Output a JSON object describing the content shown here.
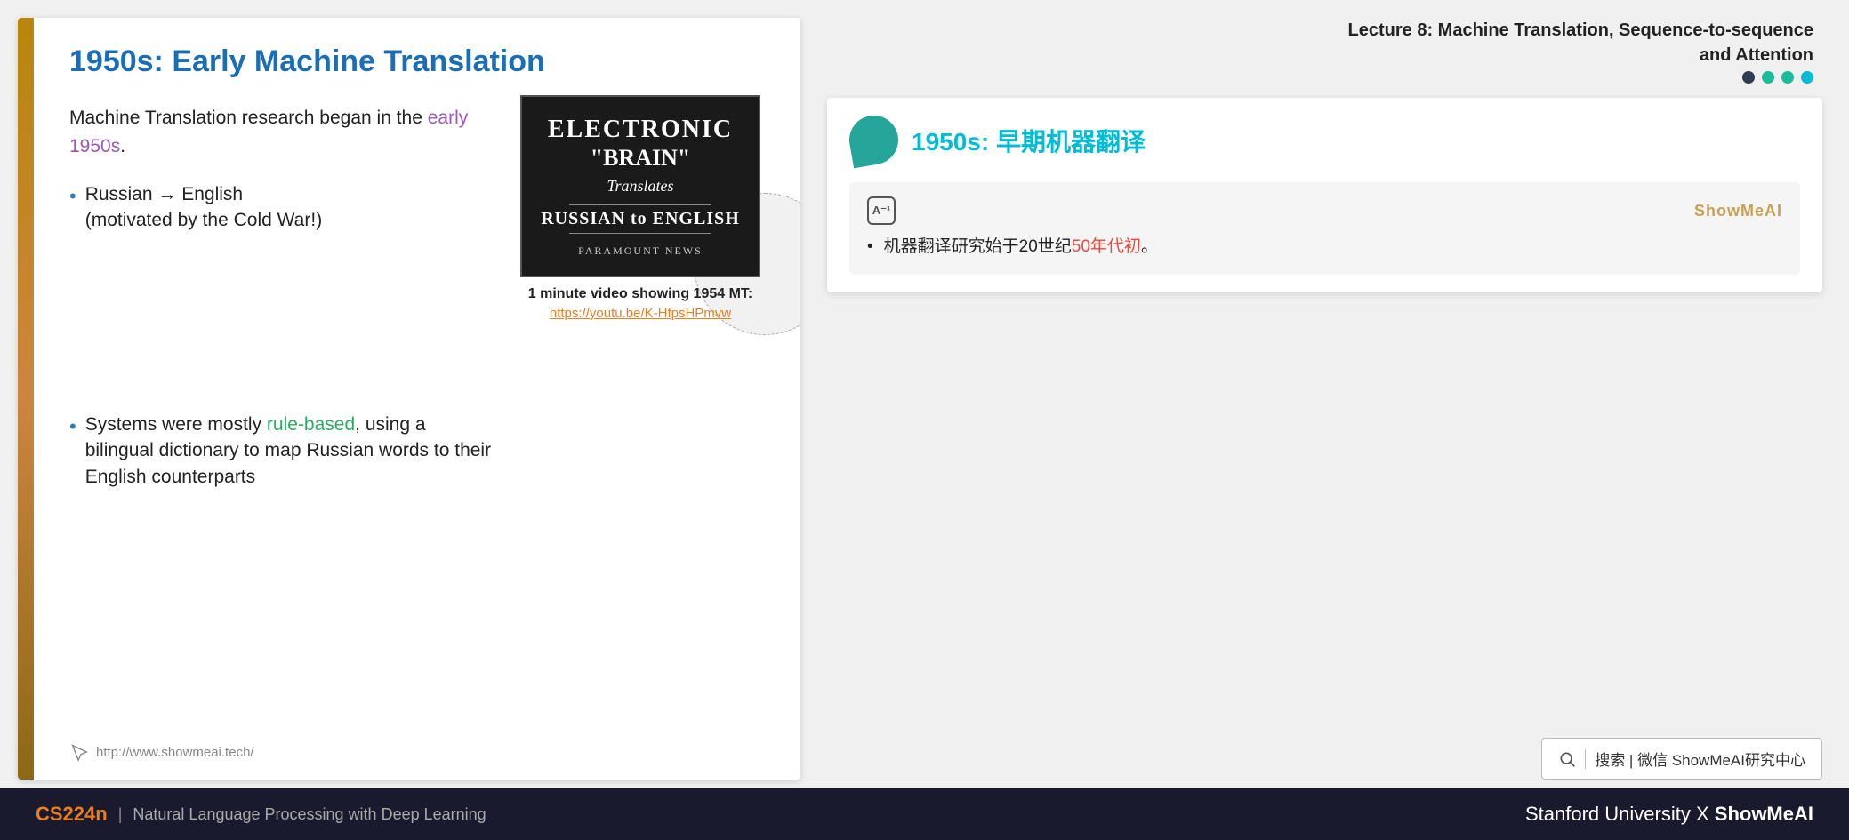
{
  "slide": {
    "title": "1950s: Early Machine Translation",
    "intro": "Machine Translation research began in the ",
    "intro_highlight": "early 1950s",
    "intro_end": ".",
    "bullet1_arrow": "Russian → English",
    "bullet1_sub": "(motivated by the Cold War!)",
    "bullet2_pre": "Systems were mostly ",
    "bullet2_highlight": "rule-based",
    "bullet2_post": ", using a bilingual dictionary to map Russian words to their English counterparts",
    "video": {
      "line1": "ELECTRONIC",
      "line2": "\"BRAIN\"",
      "line3": "Translates",
      "line4": "RUSSIAN to ENGLISH",
      "line5": "PARAMOUNT NEWS",
      "caption": "1 minute video showing 1954 MT:",
      "link": "https://youtu.be/K-HfpsHPmvw"
    },
    "footer_url": "http://www.showmeai.tech/"
  },
  "right": {
    "lecture": {
      "line1": "Lecture 8:  Machine Translation, Sequence-to-sequence",
      "line2": "and Attention"
    },
    "right_title": "1950s: 早期机器翻译",
    "card": {
      "brand": "ShowMeAI",
      "bullet_pre": "机器翻译研究始于20世纪",
      "bullet_highlight": "50年代初",
      "bullet_post": "。"
    },
    "search": {
      "text": "搜索 | 微信 ShowMeAI研究中心"
    }
  },
  "footer": {
    "course": "CS224n",
    "subtitle": "Natural Language Processing with Deep Learning",
    "right": "Stanford University",
    "x": "X",
    "brand": "ShowMeAI"
  }
}
